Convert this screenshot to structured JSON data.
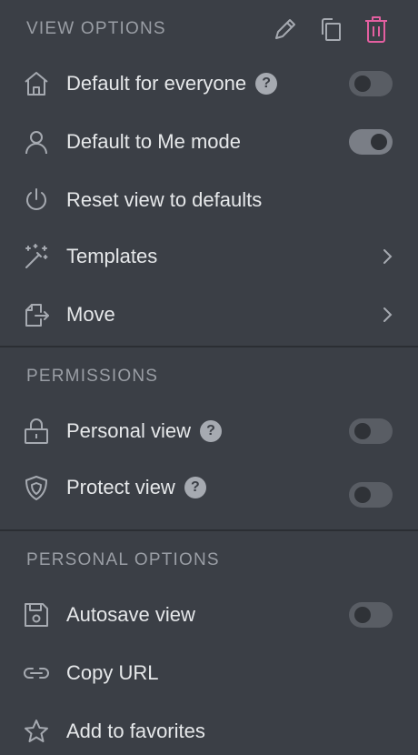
{
  "view_options": {
    "header": "VIEW OPTIONS",
    "header_icons": [
      "pencil-icon",
      "duplicate-icon",
      "trash-icon"
    ],
    "items": [
      {
        "label": "Default for everyone",
        "icon": "home-icon",
        "help": "?",
        "toggle": false
      },
      {
        "label": "Default to Me mode",
        "icon": "person-icon",
        "toggle": true
      },
      {
        "label": "Reset view to defaults",
        "icon": "power-icon"
      },
      {
        "label": "Templates",
        "icon": "magic-wand-icon",
        "submenu": true
      },
      {
        "label": "Move",
        "icon": "move-icon",
        "submenu": true
      }
    ]
  },
  "permissions": {
    "header": "PERMISSIONS",
    "items": [
      {
        "label": "Personal view",
        "icon": "lock-icon",
        "help": "?",
        "toggle": false
      },
      {
        "label": "Protect view",
        "icon": "shield-icon",
        "help": "?",
        "toggle": false
      }
    ]
  },
  "personal_options": {
    "header": "PERSONAL OPTIONS",
    "items": [
      {
        "label": "Autosave view",
        "icon": "save-icon",
        "toggle": false
      },
      {
        "label": "Copy URL",
        "icon": "link-icon"
      },
      {
        "label": "Add to favorites",
        "icon": "star-icon"
      }
    ]
  },
  "colors": {
    "background": "#3b3f46",
    "trash_accent": "#e35fa0",
    "text": "#e6e8ea",
    "muted": "#9a9ea5"
  }
}
